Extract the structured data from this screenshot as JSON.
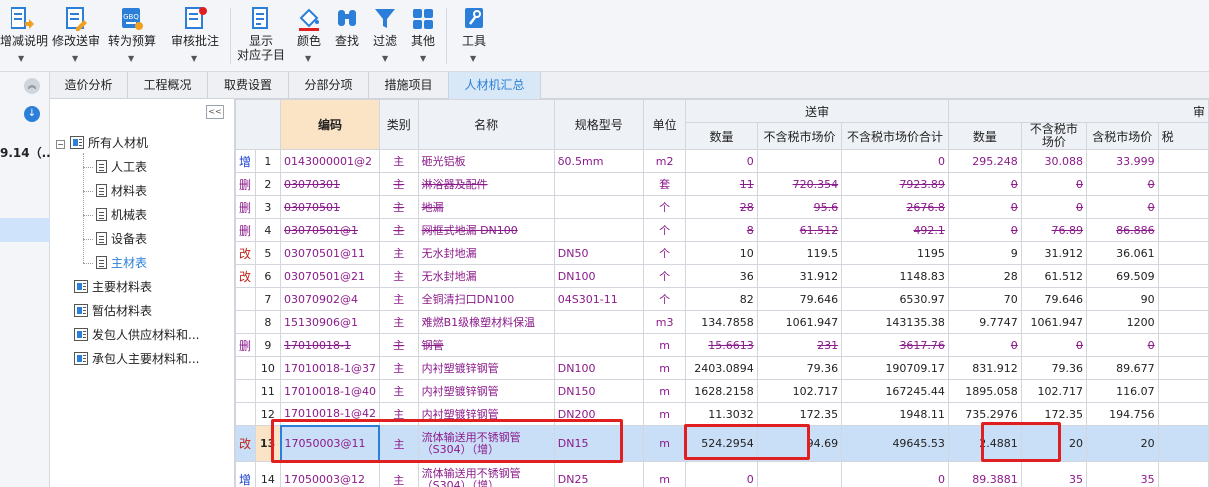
{
  "toolbar": {
    "items": [
      {
        "label": "增减说明",
        "icon": "note-icon"
      },
      {
        "label": "修改送审",
        "icon": "edit-doc-icon"
      },
      {
        "label": "转为预算",
        "icon": "convert-icon"
      },
      {
        "label": "审核批注",
        "icon": "annotate-icon"
      },
      {
        "label": "显示",
        "label2": "对应子目",
        "icon": "show-sub-icon"
      },
      {
        "label": "颜色",
        "icon": "paint-icon"
      },
      {
        "label": "查找",
        "icon": "binoculars-icon"
      },
      {
        "label": "过滤",
        "icon": "filter-icon"
      },
      {
        "label": "其他",
        "icon": "grid-icon"
      },
      {
        "label": "工具",
        "icon": "tools-icon"
      }
    ]
  },
  "leftnav": {
    "label": "9.14（..."
  },
  "tabs": [
    "造价分析",
    "工程概况",
    "取费设置",
    "分部分项",
    "措施项目",
    "人材机汇总"
  ],
  "active_tab": 5,
  "tree": {
    "root": "所有人材机",
    "children": [
      "人工表",
      "材料表",
      "机械表",
      "设备表",
      "主材表"
    ],
    "others": [
      "主要材料表",
      "暂估材料表",
      "发包人供应材料和...",
      "承包人主要材料和..."
    ]
  },
  "grid": {
    "headers": {
      "code": "编码",
      "type": "类别",
      "name": "名称",
      "spec": "规格型号",
      "unit": "单位",
      "group1": "送审",
      "group2": "审",
      "qty": "数量",
      "price_ex": "不含税市场价",
      "total_ex": "不含税市场价合计",
      "qty2": "数量",
      "price_ex2": "不含税市场价",
      "price_in2": "含税市场价",
      "partial": "税"
    },
    "rows": [
      {
        "flag": "增",
        "n": "1",
        "code": "0143000001@2",
        "type": "主",
        "name": "砸光铝板",
        "spec": "δ0.5mm",
        "unit": "m2",
        "q": "0",
        "p": "",
        "t": "0",
        "q2": "295.248",
        "p2": "30.088",
        "pi2": "33.999",
        "style": "add"
      },
      {
        "flag": "删",
        "n": "2",
        "code": "03070301",
        "type": "主",
        "name": "淋浴器及配件",
        "spec": "",
        "unit": "套",
        "q": "11",
        "p": "720.354",
        "t": "7923.89",
        "q2": "0",
        "p2": "0",
        "pi2": "0",
        "style": "del"
      },
      {
        "flag": "删",
        "n": "3",
        "code": "03070501",
        "type": "主",
        "name": "地漏",
        "spec": "",
        "unit": "个",
        "q": "28",
        "p": "95.6",
        "t": "2676.8",
        "q2": "0",
        "p2": "0",
        "pi2": "0",
        "style": "del"
      },
      {
        "flag": "删",
        "n": "4",
        "code": "03070501@1",
        "type": "主",
        "name": "网框式地漏 DN100",
        "spec": "",
        "unit": "个",
        "q": "8",
        "p": "61.512",
        "t": "492.1",
        "q2": "0",
        "p2": "76.89",
        "pi2": "86.886",
        "style": "del"
      },
      {
        "flag": "改",
        "n": "5",
        "code": "03070501@11",
        "type": "主",
        "name": "无水封地漏",
        "spec": "DN50",
        "unit": "个",
        "q": "10",
        "p": "119.5",
        "t": "1195",
        "q2": "9",
        "p2": "31.912",
        "pi2": "36.061",
        "style": "chg"
      },
      {
        "flag": "改",
        "n": "6",
        "code": "03070501@21",
        "type": "主",
        "name": "无水封地漏",
        "spec": "DN100",
        "unit": "个",
        "q": "36",
        "p": "31.912",
        "t": "1148.83",
        "q2": "28",
        "p2": "61.512",
        "pi2": "69.509",
        "style": "chg"
      },
      {
        "flag": "",
        "n": "7",
        "code": "03070902@4",
        "type": "主",
        "name": "全铜清扫口DN100",
        "spec": "04S301-11",
        "unit": "个",
        "q": "82",
        "p": "79.646",
        "t": "6530.97",
        "q2": "70",
        "p2": "79.646",
        "pi2": "90",
        "style": ""
      },
      {
        "flag": "",
        "n": "8",
        "code": "15130906@1",
        "type": "主",
        "name": "难燃B1级橡塑材料保温",
        "spec": "",
        "unit": "m3",
        "q": "134.7858",
        "p": "1061.947",
        "t": "143135.38",
        "q2": "9.7747",
        "p2": "1061.947",
        "pi2": "1200",
        "style": ""
      },
      {
        "flag": "删",
        "n": "9",
        "code": "17010018-1",
        "type": "主",
        "name": "钢管",
        "spec": "",
        "unit": "m",
        "q": "15.6613",
        "p": "231",
        "t": "3617.76",
        "q2": "0",
        "p2": "0",
        "pi2": "0",
        "style": "del"
      },
      {
        "flag": "",
        "n": "10",
        "code": "17010018-1@37",
        "type": "主",
        "name": "内衬塑镀锌钢管",
        "spec": "DN100",
        "unit": "m",
        "q": "2403.0894",
        "p": "79.36",
        "t": "190709.17",
        "q2": "831.912",
        "p2": "79.36",
        "pi2": "89.677",
        "style": ""
      },
      {
        "flag": "",
        "n": "11",
        "code": "17010018-1@40",
        "type": "主",
        "name": "内衬塑镀锌钢管",
        "spec": "DN150",
        "unit": "m",
        "q": "1628.2158",
        "p": "102.717",
        "t": "167245.44",
        "q2": "1895.058",
        "p2": "102.717",
        "pi2": "116.07",
        "style": ""
      },
      {
        "flag": "",
        "n": "12",
        "code": "17010018-1@42",
        "type": "主",
        "name": "内衬塑镀锌钢管",
        "spec": "DN200",
        "unit": "m",
        "q": "11.3032",
        "p": "172.35",
        "t": "1948.11",
        "q2": "735.2976",
        "p2": "172.35",
        "pi2": "194.756",
        "style": ""
      },
      {
        "flag": "改",
        "n": "13",
        "code": "17050003@11",
        "type": "主",
        "name": "流体输送用不锈钢管（S304）（增）",
        "spec": "DN15",
        "unit": "m",
        "q": "524.2954",
        "p": "94.69",
        "t": "49645.53",
        "q2": "2.4881",
        "p2": "20",
        "pi2": "20",
        "style": "chg sel"
      },
      {
        "flag": "增",
        "n": "14",
        "code": "17050003@12",
        "type": "主",
        "name": "流体输送用不锈钢管（S304）（增）",
        "spec": "DN25",
        "unit": "m",
        "q": "0",
        "p": "",
        "t": "0",
        "q2": "89.3881",
        "p2": "35",
        "pi2": "35",
        "style": "add"
      }
    ]
  }
}
